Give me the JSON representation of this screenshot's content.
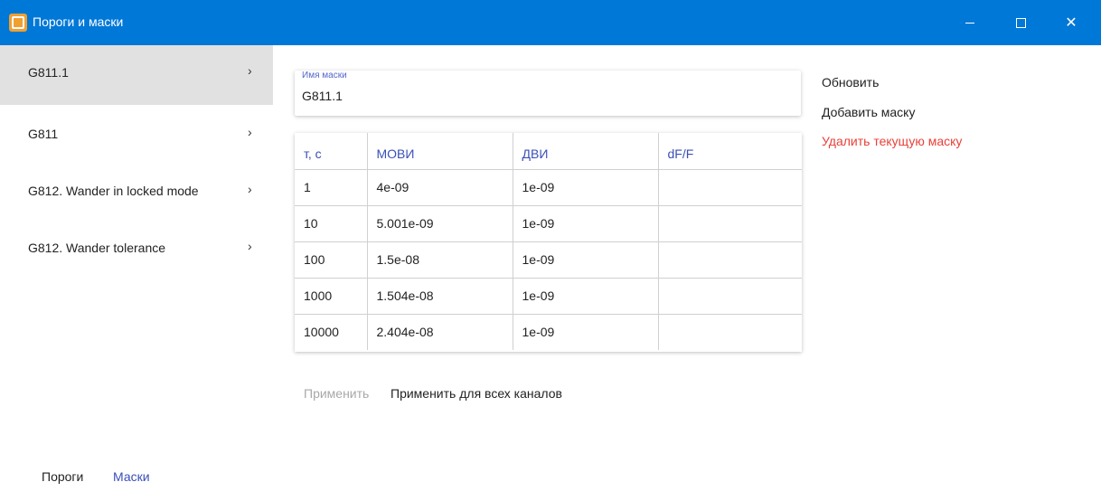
{
  "window": {
    "title": "Пороги и маски",
    "minimize_glyph": "—",
    "close_glyph": "✕"
  },
  "sidebar": {
    "items": [
      {
        "label": "G811.1",
        "chevron": "›"
      },
      {
        "label": "G811",
        "chevron": "›"
      },
      {
        "label": "G812. Wander in locked mode",
        "chevron": "›"
      },
      {
        "label": "G812. Wander tolerance",
        "chevron": "›"
      }
    ],
    "selected_index": 0
  },
  "bottom_tabs": {
    "porogi": "Пороги",
    "maski": "Маски"
  },
  "mask": {
    "label": "Имя маски",
    "value": "G811.1"
  },
  "table": {
    "headers": [
      "т, с",
      "МОВИ",
      "ДВИ",
      "dF/F"
    ],
    "rows": [
      [
        "1",
        "4e-09",
        "1e-09",
        ""
      ],
      [
        "10",
        "5.001e-09",
        "1e-09",
        ""
      ],
      [
        "100",
        "1.5e-08",
        "1e-09",
        ""
      ],
      [
        "1000",
        "1.504e-08",
        "1e-09",
        ""
      ],
      [
        "10000",
        "2.404e-08",
        "1e-09",
        ""
      ]
    ]
  },
  "buttons": {
    "apply": "Применить",
    "apply_all": "Применить для всех каналов"
  },
  "actions": {
    "refresh": "Обновить",
    "add_mask": "Добавить маску",
    "delete_mask": "Удалить текущую маску"
  },
  "colors": {
    "titlebar": "#0078d7",
    "accent": "#3a4fb8",
    "danger": "#e8403a",
    "selected_bg": "#e1e1e1"
  }
}
